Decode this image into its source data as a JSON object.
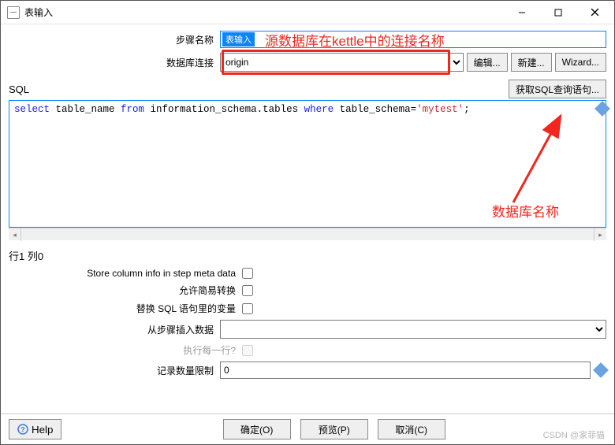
{
  "window": {
    "title": "表输入"
  },
  "form": {
    "step_name_label": "步骤名称",
    "step_name_value": "表输入",
    "db_conn_label": "数据库连接",
    "db_conn_value": "origin",
    "edit_btn": "编辑...",
    "new_btn": "新建...",
    "wizard_btn": "Wizard..."
  },
  "annotations": {
    "db_conn_hint": "源数据库在kettle中的连接名称",
    "db_name_hint": "数据库名称"
  },
  "sql": {
    "label": "SQL",
    "get_query_btn": "获取SQL查询语句...",
    "text_kw1": "select",
    "text_mid1": " table_name ",
    "text_kw2": "from",
    "text_mid2": " information_schema.tables ",
    "text_kw3": "where",
    "text_mid3": " table_schema=",
    "text_str": "'mytest'",
    "text_end": ";"
  },
  "cursor": "行1 列0",
  "options": {
    "store_col_info": "Store column info in step meta data",
    "allow_simple": "允许简易转换",
    "replace_vars": "替换 SQL 语句里的变量",
    "insert_from_step": "从步骤插入数据",
    "exec_each_row": "执行每一行?",
    "row_limit_label": "记录数量限制",
    "row_limit_value": "0"
  },
  "footer": {
    "help": "Help",
    "ok": "确定(O)",
    "preview": "预览(P)",
    "cancel": "取消(C)"
  },
  "watermark": "CSDN @家菲猫"
}
